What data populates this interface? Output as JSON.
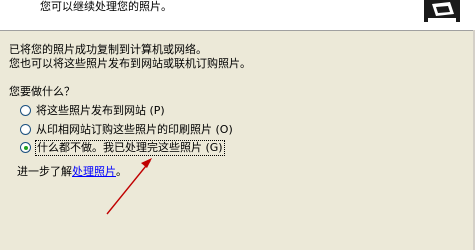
{
  "header": {
    "subtitle": "您可以继续处理您的照片。",
    "icon": "wizard-printer-icon"
  },
  "content": {
    "line1": "已将您的照片成功复制到计算机或网络。",
    "line2": "您也可以将这些照片发布到网站或联机订购照片。",
    "question": "您要做什么？",
    "options": [
      {
        "label": "将这些照片发布到网站 (P)",
        "checked": false
      },
      {
        "label": "从印相网站订购这些照片的印刷照片 (O)",
        "checked": false
      },
      {
        "label": "什么都不做。我已处理完这些照片 (G)",
        "checked": true
      }
    ],
    "learn_prefix": "进一步了解",
    "learn_link": "处理照片",
    "learn_suffix": "。"
  },
  "colors": {
    "background": "#ECE9D8",
    "link": "#0000FF",
    "annotation_arrow": "#C00000"
  }
}
